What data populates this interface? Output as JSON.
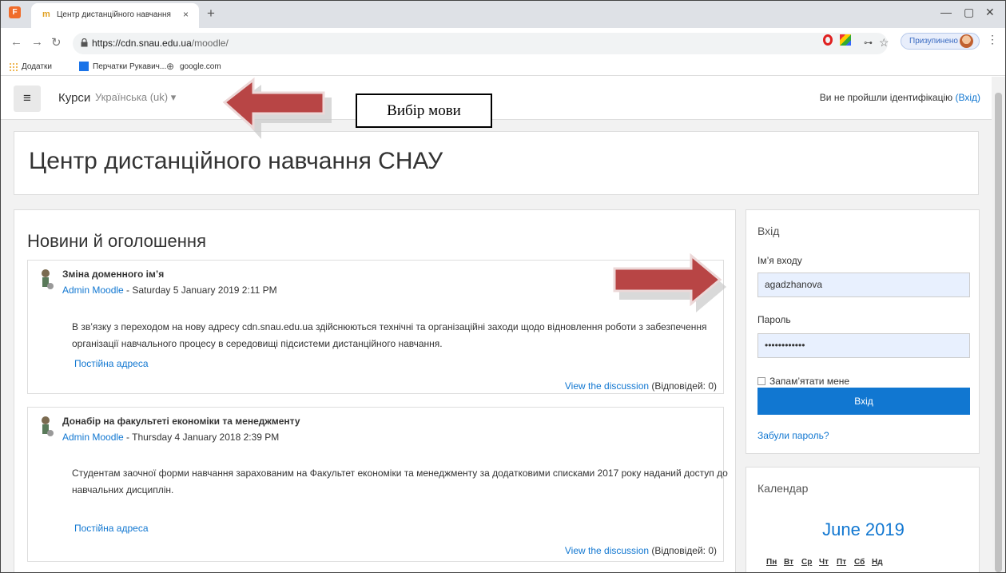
{
  "browser": {
    "tab_title": "Центр дистанційного навчання",
    "tab_close": "×",
    "new_tab": "+",
    "url_host": "https://cdn.snau.edu.ua",
    "url_path": "/moodle/",
    "paused_label": "Призупинено",
    "bookmarks": [
      "Додатки",
      "Перчатки Рукавич...",
      "google.com"
    ]
  },
  "navbar": {
    "menu_icon": "≡",
    "courses": "Курси",
    "language": "Українська (uk) ▾",
    "login_status": "Ви не пройшли ідентифікацію",
    "login_link": "(Вхід)"
  },
  "annotation": {
    "callout": "Вибір мови",
    "arrow_color": "#b84545"
  },
  "site": {
    "title": "Центр дистанційного навчання СНАУ"
  },
  "news": {
    "heading": "Новини й оголошення",
    "posts": [
      {
        "subject": "Зміна доменного ім’я",
        "author": "Admin Moodle",
        "date": " - Saturday 5 January 2019 2:11 PM",
        "body": "В зв’язку з переходом на нову адресу cdn.snau.edu.ua здійснюються технічні та організаційні заходи щодо відновлення роботи з забезпечення організації навчального процесу в середовищі підсистеми дистанційного навчання.",
        "permalink": "Постійна адреса",
        "discuss": "View the discussion",
        "replies": " (Відповідей: 0)"
      },
      {
        "subject": "Донабір на факультеті економіки та менеджменту",
        "author": "Admin Moodle",
        "date": " - Thursday 4 January 2018 2:39 PM",
        "body": "Студентам заочної форми навчання зарахованим на Факультет економіки та менеджменту за додатковими списками 2017 року наданий доступ до навчальних дисциплін.",
        "permalink": "Постійна адреса",
        "discuss": "View the discussion",
        "replies": " (Відповідей: 0)"
      }
    ]
  },
  "login": {
    "title": "Вхід",
    "username_label": "Ім’я входу",
    "username_value": "agadzhanova",
    "password_label": "Пароль",
    "password_value": "••••••••••••",
    "remember_label": "Запам’ятати мене",
    "submit_label": "Вхід",
    "forgot_label": "Забули пароль?"
  },
  "calendar": {
    "title": "Календар",
    "month": "June 2019",
    "days": [
      "Пн",
      "Вт",
      "Ср",
      "Чт",
      "Пт",
      "Сб",
      "Нд"
    ]
  },
  "colors": {
    "accent": "#1177d1",
    "annotation_arrow": "#b84545"
  }
}
